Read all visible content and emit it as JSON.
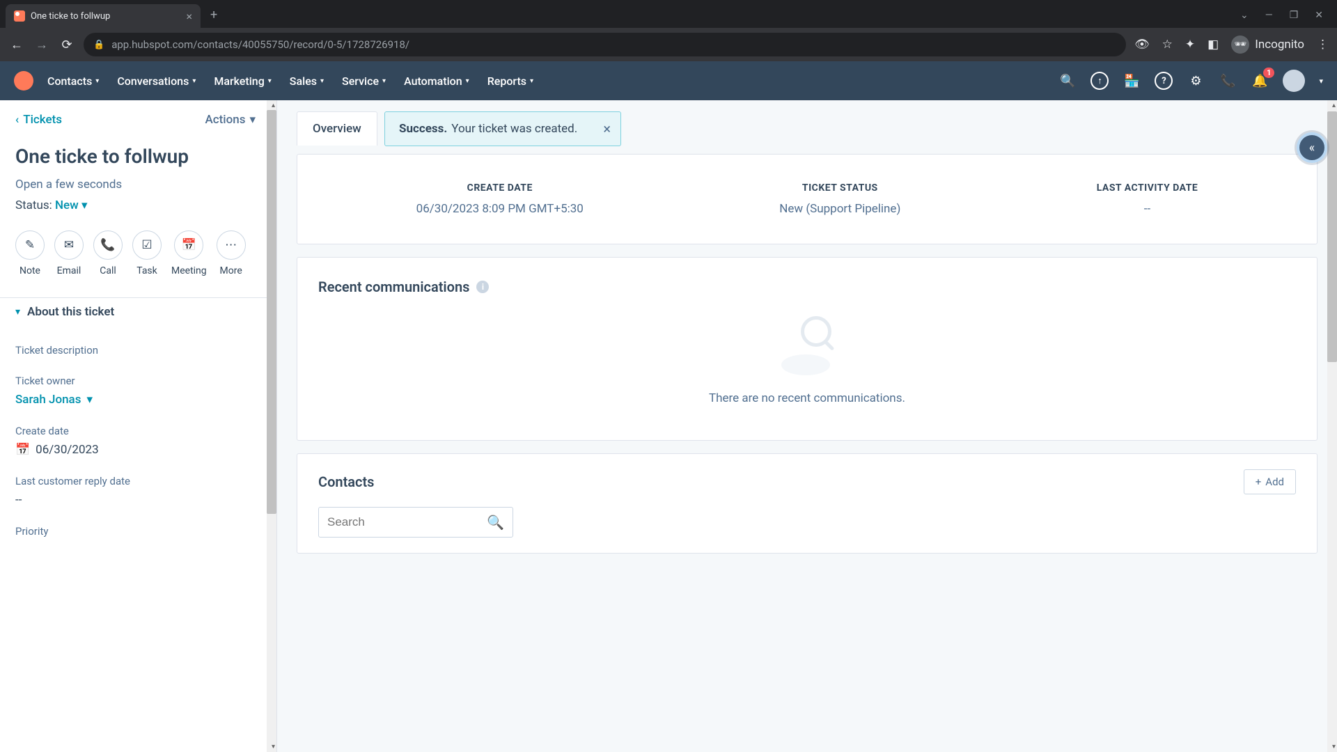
{
  "browser": {
    "tab_title": "One ticke to follwup",
    "url": "app.hubspot.com/contacts/40055750/record/0-5/1728726918/",
    "incognito_label": "Incognito"
  },
  "nav": {
    "items": [
      "Contacts",
      "Conversations",
      "Marketing",
      "Sales",
      "Service",
      "Automation",
      "Reports"
    ],
    "notification_count": "1"
  },
  "sidebar": {
    "breadcrumb": "Tickets",
    "actions_label": "Actions",
    "title": "One ticke to follwup",
    "open_line": "Open a few seconds",
    "status_label": "Status:",
    "status_value": "New",
    "actions": [
      {
        "label": "Note",
        "icon": "✎"
      },
      {
        "label": "Email",
        "icon": "✉"
      },
      {
        "label": "Call",
        "icon": "📞"
      },
      {
        "label": "Task",
        "icon": "☑"
      },
      {
        "label": "Meeting",
        "icon": "📅"
      },
      {
        "label": "More",
        "icon": "⋯"
      }
    ],
    "about_header": "About this ticket",
    "fields": {
      "desc_label": "Ticket description",
      "owner_label": "Ticket owner",
      "owner_value": "Sarah Jonas",
      "create_label": "Create date",
      "create_value": "06/30/2023",
      "reply_label": "Last customer reply date",
      "reply_value": "--",
      "priority_label": "Priority"
    }
  },
  "content": {
    "tab_overview": "Overview",
    "toast_bold": "Success.",
    "toast_rest": "Your ticket was created.",
    "summary": {
      "create_label": "CREATE DATE",
      "create_value": "06/30/2023 8:09 PM GMT+5:30",
      "status_label": "TICKET STATUS",
      "status_value": "New (Support Pipeline)",
      "activity_label": "LAST ACTIVITY DATE",
      "activity_value": "--"
    },
    "comms": {
      "title": "Recent communications",
      "empty_text": "There are no recent communications."
    },
    "contacts": {
      "title": "Contacts",
      "add_label": "Add",
      "search_placeholder": "Search"
    }
  }
}
